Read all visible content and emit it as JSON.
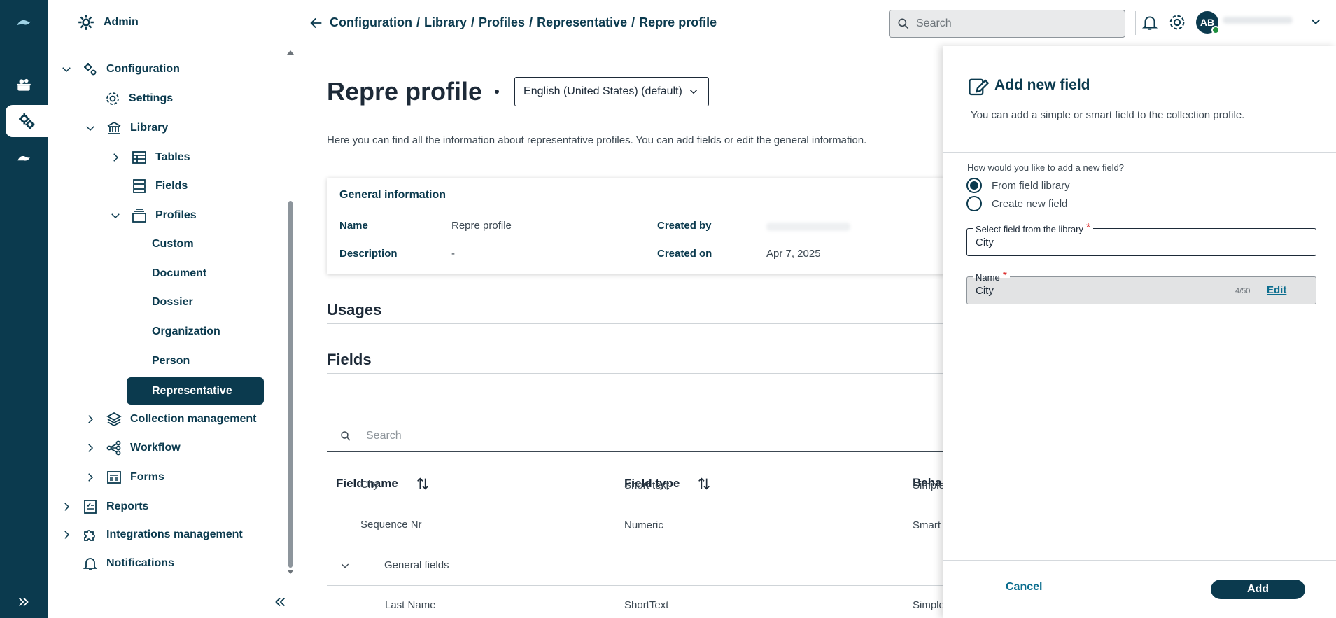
{
  "sidebar": {
    "header_label": "Admin",
    "items": [
      {
        "label": "Configuration"
      },
      {
        "label": "Settings"
      },
      {
        "label": "Library"
      },
      {
        "label": "Tables"
      },
      {
        "label": "Fields"
      },
      {
        "label": "Profiles"
      },
      {
        "label": "Custom"
      },
      {
        "label": "Document"
      },
      {
        "label": "Dossier"
      },
      {
        "label": "Organization"
      },
      {
        "label": "Person"
      },
      {
        "label": "Representative"
      },
      {
        "label": "Collection management"
      },
      {
        "label": "Workflow"
      },
      {
        "label": "Forms"
      },
      {
        "label": "Reports"
      },
      {
        "label": "Integrations management"
      },
      {
        "label": "Notifications"
      }
    ]
  },
  "topbar": {
    "breadcrumbs": [
      "Configuration",
      "Library",
      "Profiles",
      "Representative",
      "Repre profile"
    ],
    "separator": "/",
    "search_placeholder": "Search",
    "avatar_initials": "AB"
  },
  "main": {
    "title": "Repre profile",
    "language": "English (United States) (default)",
    "description": "Here you can find all the information about representative profiles. You can add fields or edit the general information.",
    "general": {
      "title": "General information",
      "name_label": "Name",
      "name_value": "Repre profile",
      "description_label": "Description",
      "description_value": "-",
      "created_by_label": "Created by",
      "created_on_label": "Created on",
      "created_on_value": "Apr 7, 2025"
    },
    "usages_heading": "Usages",
    "fields_heading": "Fields",
    "fields_search_placeholder": "Search",
    "table": {
      "headers": [
        "Field name",
        "Field type",
        "Beha"
      ],
      "rows": [
        {
          "name": "City",
          "type": "Short text",
          "behavior": "Simple"
        },
        {
          "name": "Sequence Nr",
          "type": "Numeric",
          "behavior": "Smart"
        },
        {
          "name": "General fields",
          "type": "",
          "behavior": ""
        },
        {
          "name": "Last Name",
          "type": "ShortText",
          "behavior": "Simple"
        }
      ]
    }
  },
  "drawer": {
    "title": "Add new field",
    "subtitle": "You can add a simple or smart field to the collection profile.",
    "question": "How would you like to add a new field?",
    "option_library": "From field library",
    "option_new": "Create new field",
    "selected_option": "From field library",
    "library_field_label": "Select field from the library",
    "library_field_value": "City",
    "name_label": "Name",
    "name_value": "City",
    "name_counter": "4/50",
    "edit_label": "Edit",
    "cancel_label": "Cancel",
    "add_label": "Add"
  },
  "colors": {
    "brand": "#0b3a4e",
    "link": "#0b6d8e",
    "required": "#d91c1c",
    "online": "#1e8e3e"
  }
}
